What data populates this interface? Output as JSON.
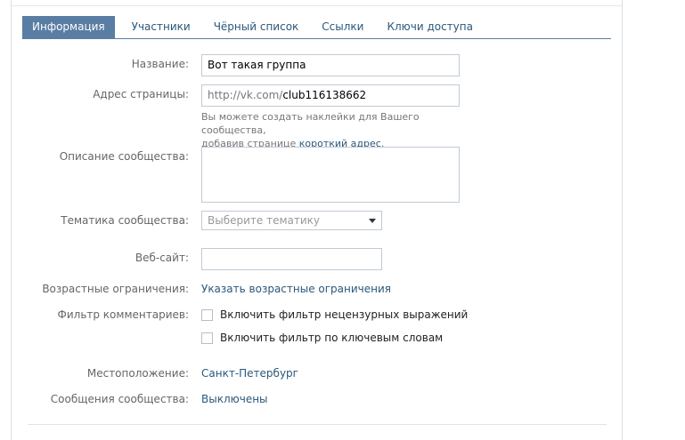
{
  "tabs": [
    "Информация",
    "Участники",
    "Чёрный список",
    "Ссылки",
    "Ключи доступа"
  ],
  "active_tab": 0,
  "form": {
    "name": {
      "label": "Название:",
      "value": "Вот такая группа"
    },
    "address": {
      "label": "Адрес страницы:",
      "prefix": "http://vk.com/",
      "value": "club116138662",
      "hint_line1": "Вы можете создать наклейки для Вашего сообщества,",
      "hint_line2_text": "добавив странице ",
      "hint_line2_link": "короткий адрес",
      "hint_line2_end": "."
    },
    "description": {
      "label": "Описание сообщества:",
      "value": ""
    },
    "topic": {
      "label": "Тематика сообщества:",
      "placeholder": "Выберите тематику"
    },
    "website": {
      "label": "Веб-сайт:",
      "value": ""
    },
    "age": {
      "label": "Возрастные ограничения:",
      "link": "Указать возрастные ограничения"
    },
    "comments_filter": {
      "label": "Фильтр комментариев:",
      "options": [
        {
          "label": "Включить фильтр нецензурных выражений",
          "checked": false
        },
        {
          "label": "Включить фильтр по ключевым словам",
          "checked": false
        }
      ]
    },
    "location": {
      "label": "Местоположение:",
      "value": "Санкт-Петербург"
    },
    "messages": {
      "label": "Сообщения сообщества:",
      "value": "Выключены"
    }
  },
  "colors": {
    "accent": "#597da3",
    "link": "#2b587a",
    "label": "#666666",
    "border": "#c0cad5"
  }
}
